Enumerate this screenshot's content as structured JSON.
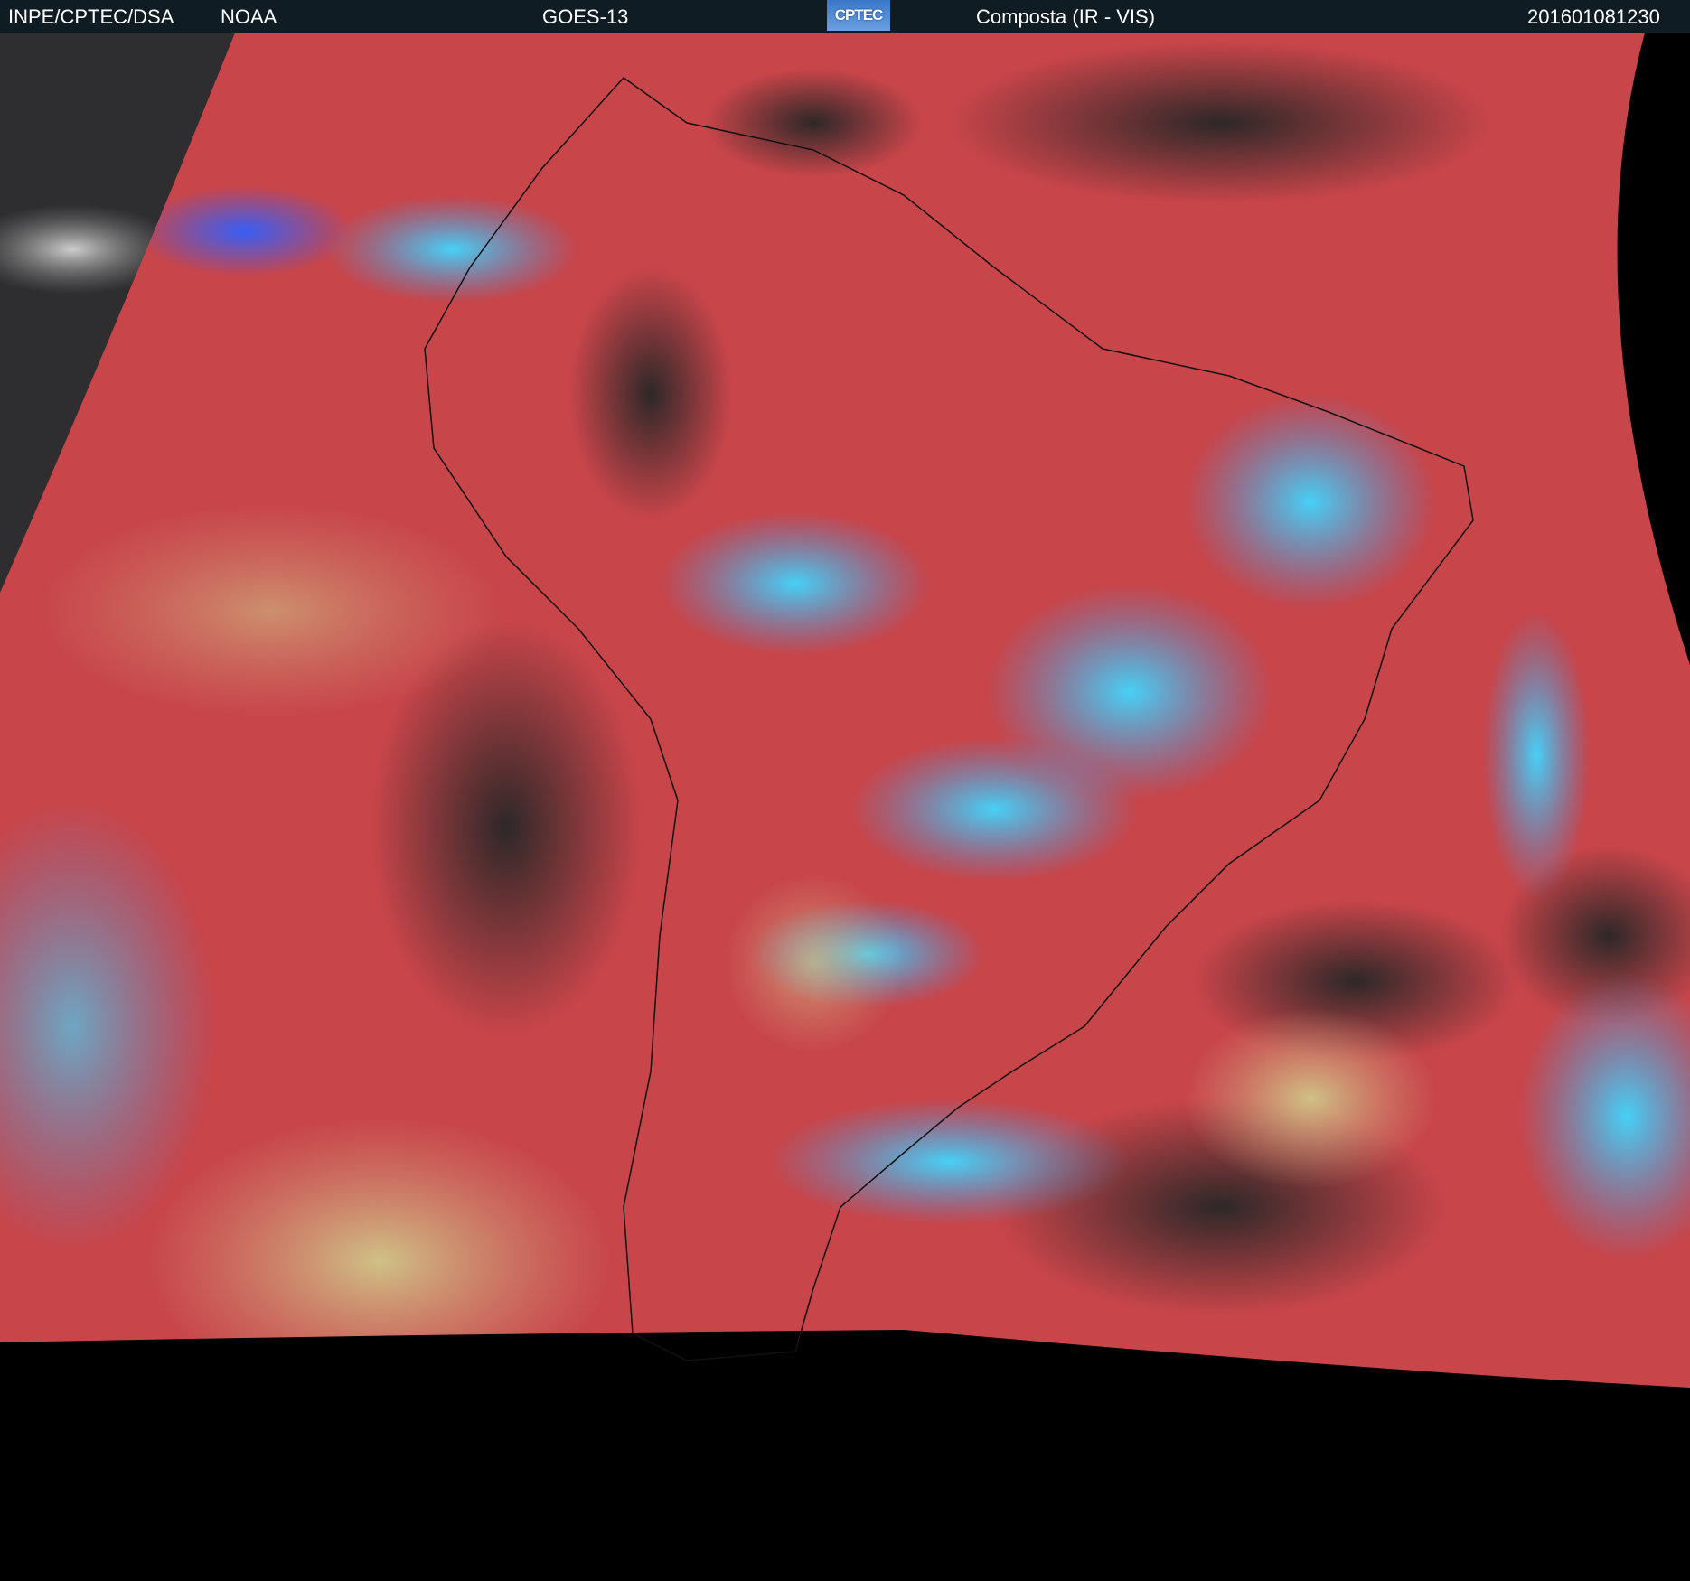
{
  "header": {
    "institution": "INPE/CPTEC/DSA",
    "agency": "NOAA",
    "satellite": "GOES-13",
    "logo_text": "CPTEC",
    "product": "Composta (IR - VIS)",
    "timestamp": "201601081230"
  },
  "colors": {
    "header_bg": "#0f1c24",
    "clear_sky_red": "#c8454a",
    "high_cloud_cyan": "#3cc8f0",
    "low_cloud_yellow": "#c8c080",
    "dark_surface": "#2a2a2a"
  }
}
